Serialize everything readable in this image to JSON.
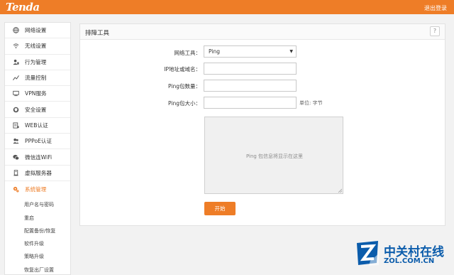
{
  "header": {
    "brand": "Tenda",
    "logout": "退出登录"
  },
  "sidebar": {
    "items": [
      {
        "label": "网络设置",
        "icon": "globe-icon"
      },
      {
        "label": "无线设置",
        "icon": "wifi-icon"
      },
      {
        "label": "行为管理",
        "icon": "user-manage-icon"
      },
      {
        "label": "流量控制",
        "icon": "traffic-icon"
      },
      {
        "label": "VPN服务",
        "icon": "monitor-icon"
      },
      {
        "label": "安全设置",
        "icon": "shield-icon"
      },
      {
        "label": "WEB认证",
        "icon": "web-auth-icon"
      },
      {
        "label": "PPPoE认证",
        "icon": "pppoe-icon"
      },
      {
        "label": "微信连WiFi",
        "icon": "wechat-icon"
      },
      {
        "label": "虚拟服务器",
        "icon": "server-icon"
      },
      {
        "label": "系统管理",
        "icon": "gear-icon",
        "active": true
      }
    ],
    "sub_items": [
      "用户名与密码",
      "重启",
      "配置备份/恢复",
      "软件升级",
      "策略升级",
      "恢复出厂设置"
    ]
  },
  "panel": {
    "title": "排障工具",
    "help": "?",
    "tool_label": "网络工具：",
    "tool_value": "Ping",
    "host_label": "IP地址或域名：",
    "host_value": "",
    "count_label": "Ping包数量：",
    "count_value": "",
    "size_label": "Ping包大小：",
    "size_value": "",
    "size_unit": "单位: 字节",
    "result_placeholder": "Ping 包信息将显示在这里",
    "start_button": "开始"
  },
  "watermark": {
    "cn": "中关村在线",
    "en": "ZOL.COM.CN"
  },
  "colors": {
    "accent": "#ee7d27",
    "watermark": "#0b5cab"
  }
}
